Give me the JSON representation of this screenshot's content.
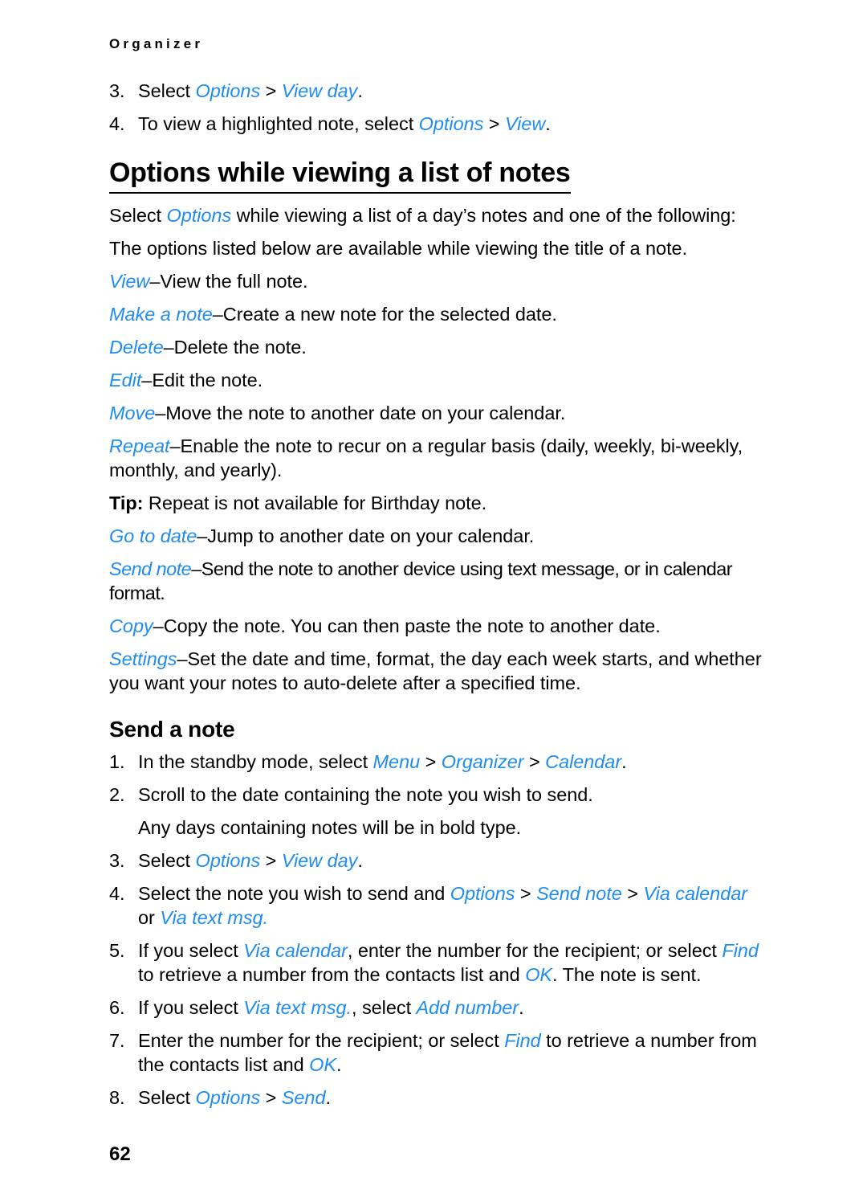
{
  "document": {
    "running_header": "Organizer",
    "page_number": "62",
    "accent_color": "#1f8cf0",
    "text_color": "#000000",
    "background_color": "#ffffff"
  },
  "top_steps": [
    {
      "number": "3.",
      "parts": [
        {
          "t": "Select ",
          "s": "plain"
        },
        {
          "t": "Options",
          "s": "ui"
        },
        {
          "t": " > ",
          "s": "sep"
        },
        {
          "t": "View day",
          "s": "ui"
        },
        {
          "t": ".",
          "s": "plain"
        }
      ]
    },
    {
      "number": "4.",
      "parts": [
        {
          "t": "To view a highlighted note, select ",
          "s": "plain"
        },
        {
          "t": "Options",
          "s": "ui"
        },
        {
          "t": " > ",
          "s": "sep"
        },
        {
          "t": "View",
          "s": "ui"
        },
        {
          "t": ".",
          "s": "plain"
        }
      ]
    }
  ],
  "section_options": {
    "heading": "Options while viewing a list of notes",
    "intro": [
      {
        "t": "Select ",
        "s": "plain"
      },
      {
        "t": "Options",
        "s": "ui"
      },
      {
        "t": " while viewing a list of a day’s notes and one of the following:",
        "s": "plain"
      }
    ],
    "note": "The options listed below are available while viewing the title of a note.",
    "items": [
      {
        "term": "View",
        "desc": "–View the full note."
      },
      {
        "term": "Make a note",
        "desc": "–Create a new note for the selected date."
      },
      {
        "term": "Delete",
        "desc": "–Delete the note."
      },
      {
        "term": "Edit",
        "desc": "–Edit the note."
      },
      {
        "term": "Move",
        "desc": "–Move the note to another date on your calendar."
      },
      {
        "term": "Repeat",
        "desc": "–Enable the note to recur on a regular basis (daily, weekly, bi-weekly, monthly, and yearly)."
      }
    ],
    "tip": {
      "label": "Tip:",
      "text": " Repeat is not available for Birthday note."
    },
    "items_after_tip": [
      {
        "term": "Go to date",
        "desc": "–Jump to another date on your calendar."
      },
      {
        "term": "Send note",
        "desc": "–Send the note to another device using text message, or in calendar format."
      },
      {
        "term": "Copy",
        "desc": "–Copy the note. You can then paste the note to another date."
      },
      {
        "term": "Settings",
        "desc": "–Set the date and time, format, the day each week starts, and whether you want your notes to auto-delete after a specified time."
      }
    ]
  },
  "section_send": {
    "heading": "Send a note",
    "steps": [
      {
        "number": "1.",
        "parts": [
          {
            "t": "In the standby mode, select ",
            "s": "plain"
          },
          {
            "t": "Menu",
            "s": "ui"
          },
          {
            "t": " > ",
            "s": "sep"
          },
          {
            "t": "Organizer",
            "s": "ui"
          },
          {
            "t": " > ",
            "s": "sep"
          },
          {
            "t": "Calendar",
            "s": "ui"
          },
          {
            "t": ".",
            "s": "plain"
          }
        ]
      },
      {
        "number": "2.",
        "parts": [
          {
            "t": "Scroll to the date containing the note you wish to send.",
            "s": "plain"
          }
        ]
      },
      {
        "number": "",
        "continuation": true,
        "parts": [
          {
            "t": "Any days containing notes will be in bold type.",
            "s": "plain"
          }
        ]
      },
      {
        "number": "3.",
        "parts": [
          {
            "t": "Select ",
            "s": "plain"
          },
          {
            "t": "Options",
            "s": "ui"
          },
          {
            "t": " > ",
            "s": "sep"
          },
          {
            "t": "View day",
            "s": "ui"
          },
          {
            "t": ".",
            "s": "plain"
          }
        ]
      },
      {
        "number": "4.",
        "parts": [
          {
            "t": "Select the note you wish to send and ",
            "s": "plain"
          },
          {
            "t": "Options",
            "s": "ui"
          },
          {
            "t": " > ",
            "s": "sep"
          },
          {
            "t": "Send note",
            "s": "ui"
          },
          {
            "t": " > ",
            "s": "sep"
          },
          {
            "t": "Via calendar",
            "s": "ui"
          },
          {
            "t": " or ",
            "s": "plain"
          },
          {
            "t": "Via text msg.",
            "s": "ui"
          }
        ]
      },
      {
        "number": "5.",
        "parts": [
          {
            "t": "If you select ",
            "s": "plain"
          },
          {
            "t": "Via calendar",
            "s": "ui"
          },
          {
            "t": ", enter the number for the recipient; or select ",
            "s": "plain"
          },
          {
            "t": "Find",
            "s": "ui"
          },
          {
            "t": " to retrieve a number from the contacts list and ",
            "s": "plain"
          },
          {
            "t": "OK",
            "s": "ui"
          },
          {
            "t": ". The note is sent.",
            "s": "plain"
          }
        ]
      },
      {
        "number": "6.",
        "parts": [
          {
            "t": "If you select ",
            "s": "plain"
          },
          {
            "t": "Via text msg.",
            "s": "ui"
          },
          {
            "t": ", select ",
            "s": "plain"
          },
          {
            "t": "Add number",
            "s": "ui"
          },
          {
            "t": ".",
            "s": "plain"
          }
        ]
      },
      {
        "number": "7.",
        "parts": [
          {
            "t": "Enter the number for the recipient; or select ",
            "s": "plain"
          },
          {
            "t": "Find",
            "s": "ui"
          },
          {
            "t": " to retrieve a number from the contacts list and ",
            "s": "plain"
          },
          {
            "t": "OK",
            "s": "ui"
          },
          {
            "t": ".",
            "s": "plain"
          }
        ]
      },
      {
        "number": "8.",
        "parts": [
          {
            "t": "Select ",
            "s": "plain"
          },
          {
            "t": "Options",
            "s": "ui"
          },
          {
            "t": " > ",
            "s": "sep"
          },
          {
            "t": "Send",
            "s": "ui"
          },
          {
            "t": ".",
            "s": "plain"
          }
        ]
      }
    ]
  }
}
